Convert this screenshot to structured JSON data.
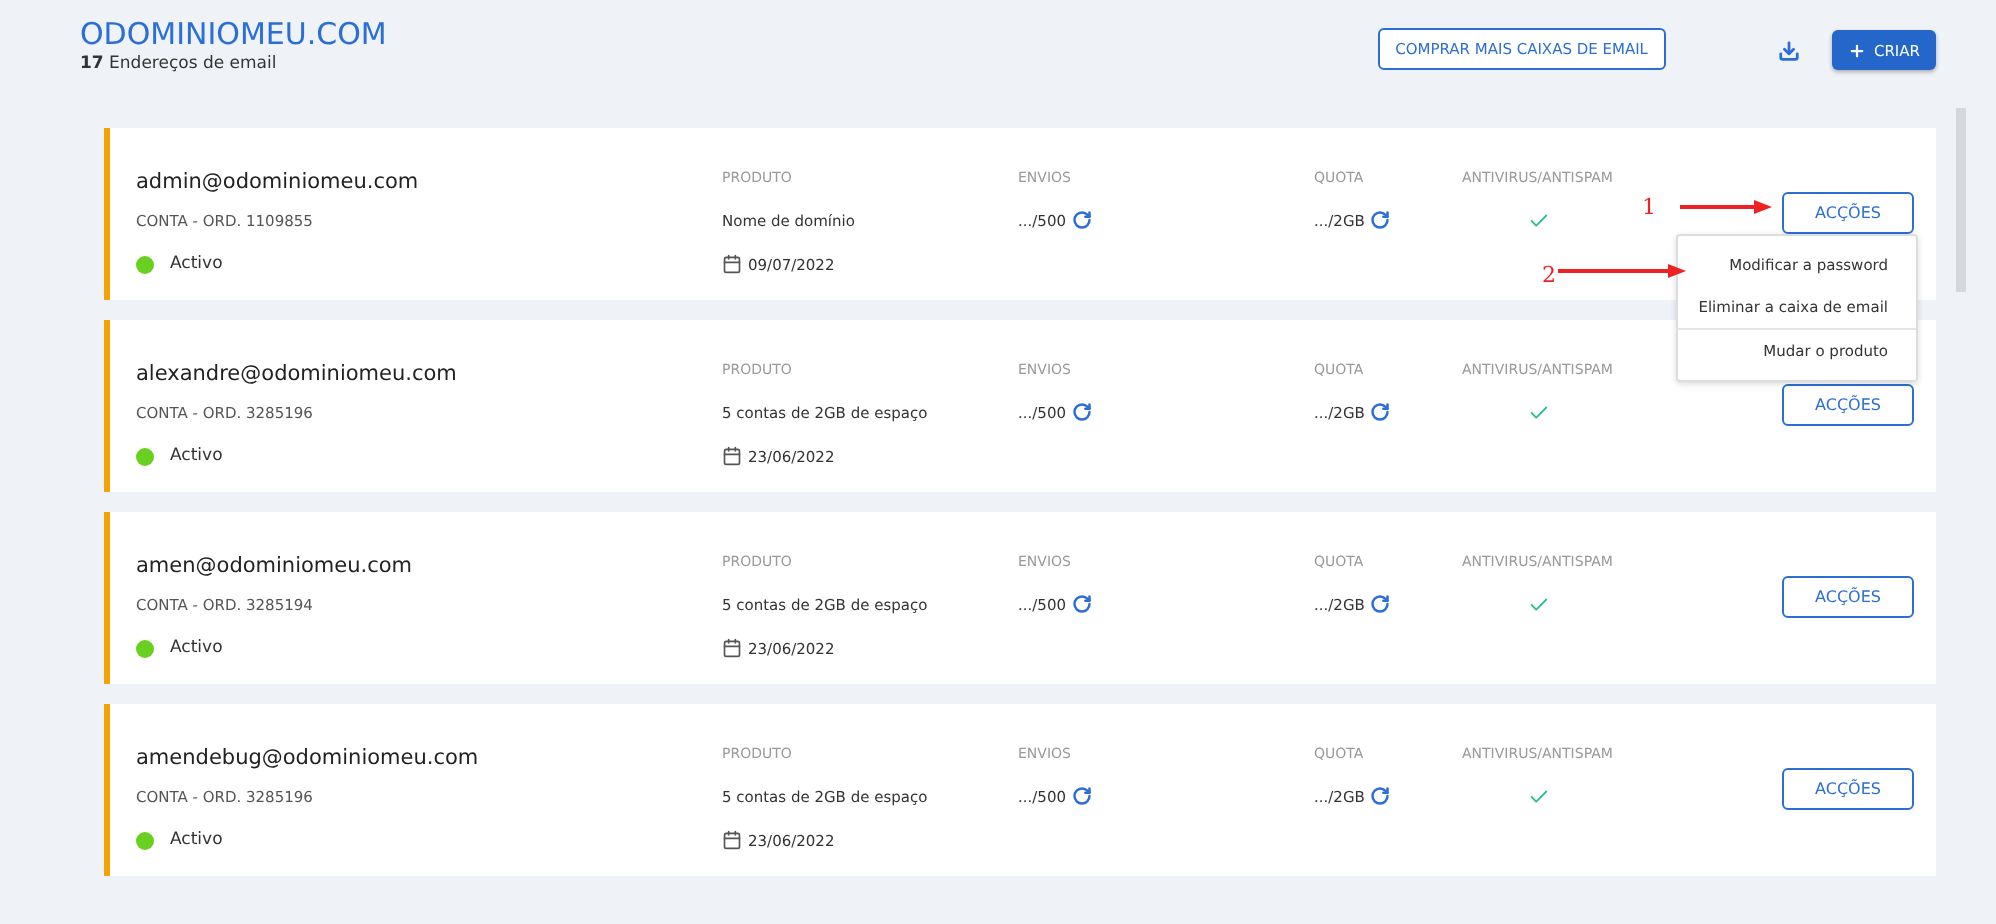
{
  "header": {
    "title": "ODOMINIOMEU.COM",
    "subtitle": "**17** Endereços de email",
    "buy_button": "COMPRAR MAIS CAIXAS DE EMAIL",
    "create_button": "CRIAR"
  },
  "accounts": [
    {
      "email": "admin@odominiomeu.com",
      "order": "CONTA - ORD. 1109855",
      "status": "Activo",
      "active": true,
      "labels": [
        "PRODUTO",
        "ENVIOS",
        "QUOTA",
        "ANTIVIRUS/ANTISPAM"
      ],
      "product": "Nome de domínio",
      "date": "09/07/2022",
      "sends": ".../500",
      "quota": ".../2GB",
      "antivirus": true,
      "actions_button": "ACÇÕES",
      "menu": [
        "Modificar a password",
        "Eliminar a caixa de email",
        "Mudar o produto"
      ]
    },
    {
      "email": "alexandre@odominiomeu.com",
      "order": "CONTA - ORD. 3285196",
      "status": "Activo",
      "active": true,
      "labels": [
        "PRODUTO",
        "ENVIOS",
        "QUOTA",
        "ANTIVIRUS/ANTISPAM"
      ],
      "product": "5 contas de 2GB de espaço",
      "date": "23/06/2022",
      "sends": ".../500",
      "quota": ".../2GB",
      "antivirus": true,
      "actions_button": "ACÇÕES"
    },
    {
      "email": "amen@odominiomeu.com",
      "order": "CONTA - ORD. 3285194",
      "status": "Activo",
      "active": true,
      "labels": [
        "PRODUTO",
        "ENVIOS",
        "QUOTA",
        "ANTIVIRUS/ANTISPAM"
      ],
      "product": "5 contas de 2GB de espaço",
      "date": "23/06/2022",
      "sends": ".../500",
      "quota": ".../2GB",
      "antivirus": true,
      "actions_button": "ACÇÕES"
    },
    {
      "email": "amendebug@odominiomeu.com",
      "order": "CONTA - ORD. 3285196",
      "status": "Activo",
      "active": true,
      "labels": [
        "PRODUTO",
        "ENVIOS",
        "QUOTA",
        "ANTIVIRUS/ANTISPAM"
      ],
      "product": "5 contas de 2GB de espaço",
      "date": "23/06/2022",
      "sends": ".../500",
      "quota": ".../2GB",
      "antivirus": true,
      "actions_button": "ACÇÕES"
    }
  ],
  "annotations": [
    {
      "label": "1"
    },
    {
      "label": "2"
    }
  ]
}
